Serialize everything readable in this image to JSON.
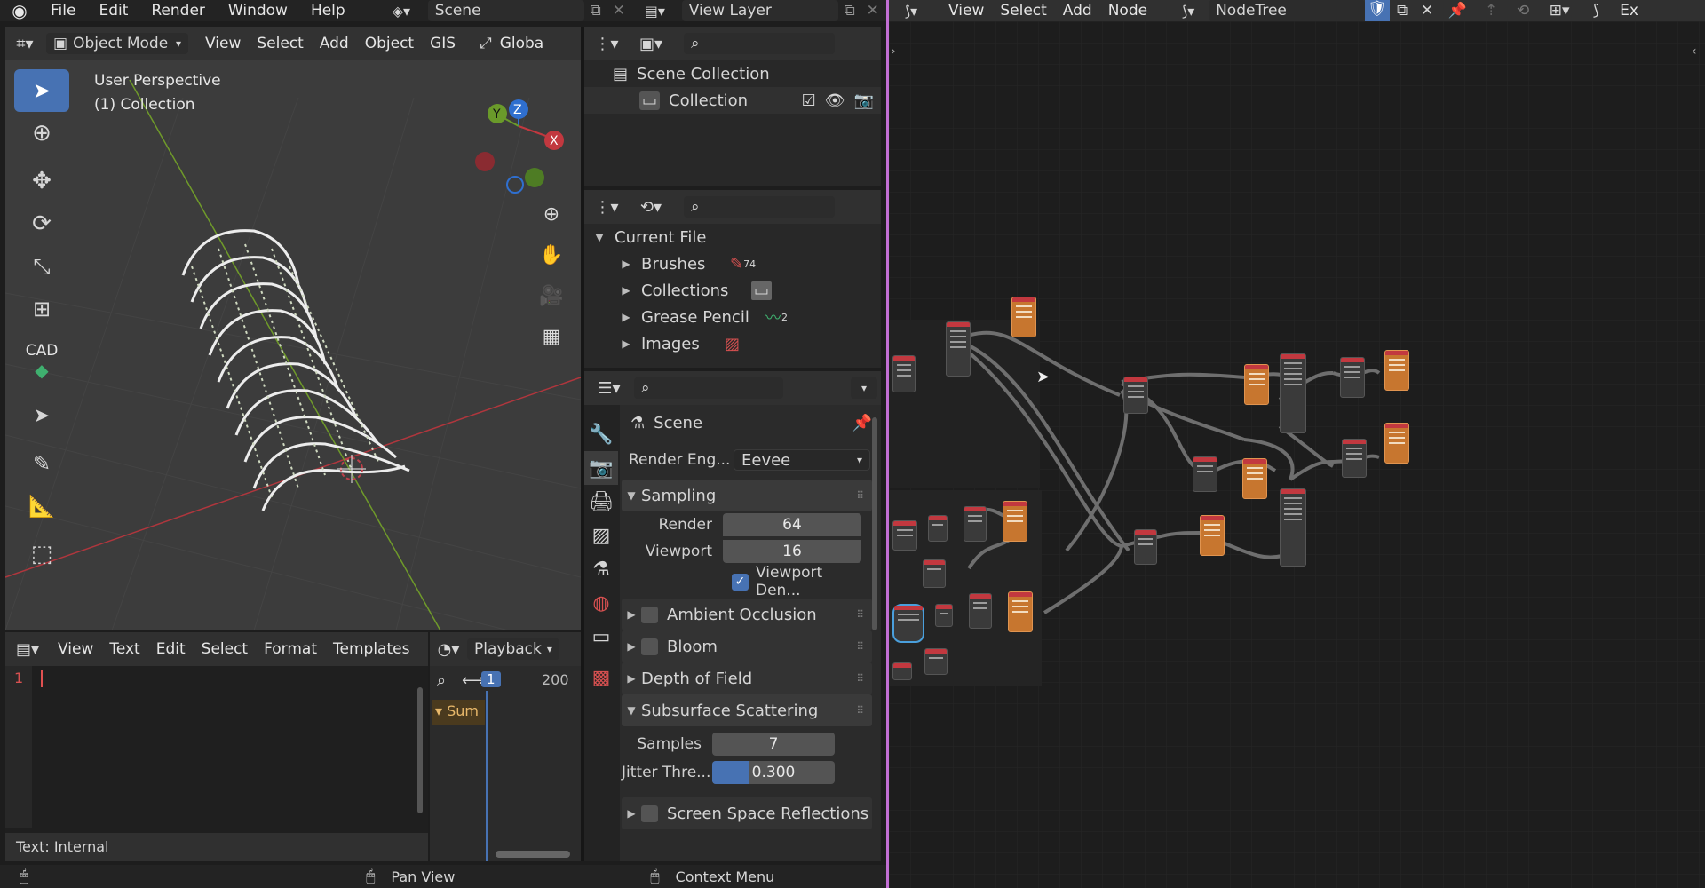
{
  "topbar": {
    "menus": [
      "File",
      "Edit",
      "Render",
      "Window",
      "Help"
    ],
    "scene_name": "Scene",
    "view_layer": "View Layer"
  },
  "viewport": {
    "header": {
      "mode": "Object Mode",
      "menus": [
        "View",
        "Select",
        "Add",
        "Object",
        "GIS"
      ],
      "orientation": "Globa"
    },
    "overlay": {
      "perspective": "User Perspective",
      "collection": "(1) Collection"
    },
    "gizmo": {
      "y": "Y",
      "z": "Z",
      "x": "X"
    },
    "tools": [
      {
        "name": "select-box-tool",
        "icon": "cursor-icon"
      },
      {
        "name": "cursor-tool",
        "icon": "3d-cursor-icon"
      },
      {
        "name": "move-tool",
        "icon": "move-icon"
      },
      {
        "name": "rotate-tool",
        "icon": "rotate-icon"
      },
      {
        "name": "scale-tool",
        "icon": "scale-icon"
      },
      {
        "name": "transform-tool",
        "icon": "transform-icon"
      }
    ],
    "cad_label": "CAD"
  },
  "text_editor": {
    "menus": [
      "View",
      "Text",
      "Edit",
      "Select",
      "Format",
      "Templates"
    ],
    "line_number": "1",
    "footer": "Text: Internal"
  },
  "timeline": {
    "playback": "Playback",
    "current_frame": "1",
    "end_frame": "200",
    "summary": "Sum"
  },
  "outliner": {
    "scene_collection": "Scene Collection",
    "collection": "Collection"
  },
  "blend_file": {
    "root": "Current File",
    "items": [
      {
        "label": "Brushes",
        "count": "74"
      },
      {
        "label": "Collections",
        "count": ""
      },
      {
        "label": "Grease Pencil",
        "count": "2"
      },
      {
        "label": "Images",
        "count": ""
      }
    ]
  },
  "properties": {
    "context": "Scene",
    "render_engine_label": "Render Eng...",
    "render_engine": "Eevee",
    "sampling": {
      "title": "Sampling",
      "render_label": "Render",
      "render_value": "64",
      "viewport_label": "Viewport",
      "viewport_value": "16",
      "denoise_label": "Viewport Den..."
    },
    "panels": [
      "Ambient Occlusion",
      "Bloom",
      "Depth of Field"
    ],
    "sss": {
      "title": "Subsurface Scattering",
      "samples_label": "Samples",
      "samples_value": "7",
      "jitter_label": "Jitter Thre...",
      "jitter_value": "0.300",
      "jitter_fraction": 0.3
    },
    "ssr": "Screen Space Reflections"
  },
  "node_editor": {
    "menus": [
      "View",
      "Select",
      "Add",
      "Node"
    ],
    "tree_name": "NodeTree",
    "right_label": "Ex"
  },
  "statusbar": {
    "pan": "Pan View",
    "context": "Context Menu"
  }
}
